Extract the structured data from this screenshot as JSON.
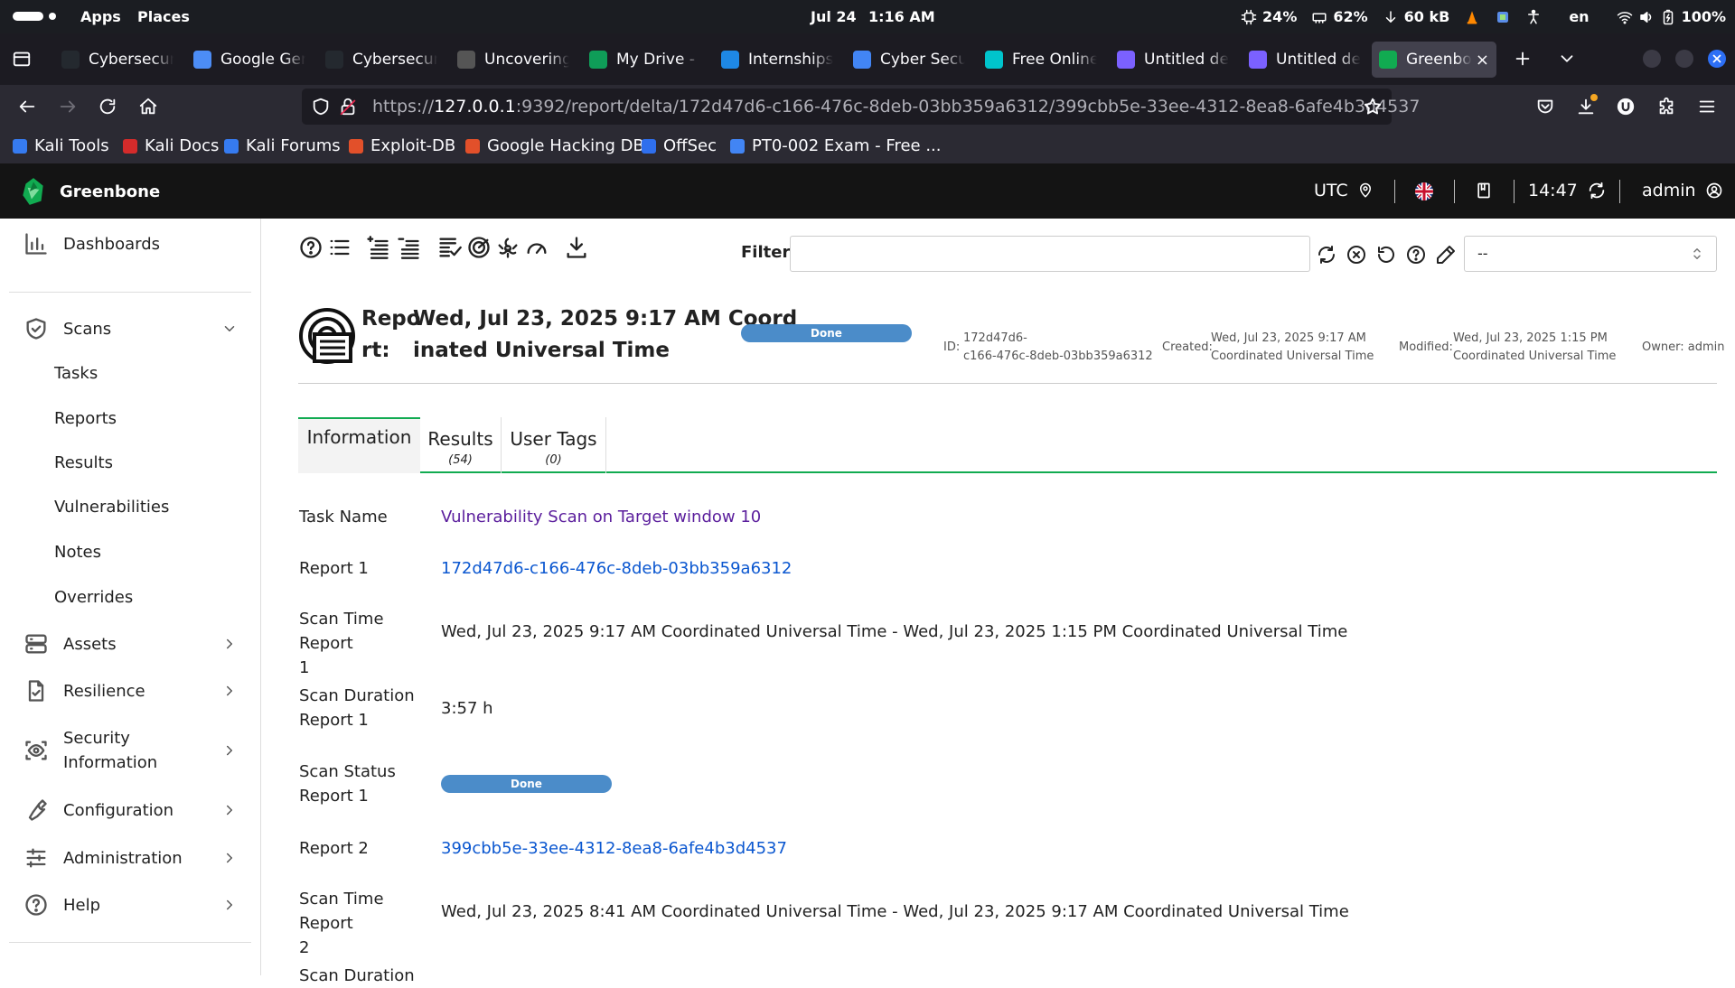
{
  "topbar": {
    "apps": "Apps",
    "places": "Places",
    "date": "Jul 24",
    "time": "1:16 AM",
    "cpu": "24%",
    "mem": "62%",
    "net": "60 kB",
    "lang": "en",
    "battery": "100%"
  },
  "tabs": [
    {
      "label": "Cybersecur",
      "color": "#24292f"
    },
    {
      "label": "Google Ger",
      "color": "#4c8df6"
    },
    {
      "label": "Cybersecur",
      "color": "#24292f"
    },
    {
      "label": "Uncovering",
      "color": "#555555"
    },
    {
      "label": "My Drive - (",
      "color": "#0f9d58"
    },
    {
      "label": "Internships",
      "color": "#1e88e5"
    },
    {
      "label": "Cyber Secu",
      "color": "#4285f4"
    },
    {
      "label": "Free Online",
      "color": "#00c4cc"
    },
    {
      "label": "Untitled de",
      "color": "#7b61ff"
    },
    {
      "label": "Untitled de",
      "color": "#7b61ff"
    },
    {
      "label": "Greenbo",
      "color": "#11ab51",
      "active": true,
      "close": "×"
    }
  ],
  "url": {
    "proto": "https://",
    "host": "127.0.0.1",
    "path": ":9392/report/delta/172d47d6-c166-476c-8deb-03bb359a6312/399cbb5e-33ee-4312-8ea8-6afe4b3d4537"
  },
  "bookmarks": [
    {
      "label": "Kali Tools",
      "color": "#367bf0"
    },
    {
      "label": "Kali Docs",
      "color": "#d42b2b"
    },
    {
      "label": "Kali Forums",
      "color": "#367bf0"
    },
    {
      "label": "Exploit-DB",
      "color": "#e2502a"
    },
    {
      "label": "Google Hacking DB",
      "color": "#e2502a"
    },
    {
      "label": "OffSec",
      "color": "#2f6fed"
    },
    {
      "label": "PT0-002 Exam - Free ...",
      "color": "#4285f4"
    }
  ],
  "gsa_header": {
    "brand": "Greenbone",
    "timezone": "UTC",
    "clock": "14:47",
    "user": "admin"
  },
  "sidebar": {
    "dashboards": "Dashboards",
    "scans": "Scans",
    "scan_items": [
      "Tasks",
      "Reports",
      "Results",
      "Vulnerabilities",
      "Notes",
      "Overrides"
    ],
    "assets": "Assets",
    "resilience": "Resilience",
    "security_info_1": "Security",
    "security_info_2": "Information",
    "configuration": "Configuration",
    "administration": "Administration",
    "help": "Help"
  },
  "filter": {
    "label": "Filter",
    "value": "",
    "select": "--"
  },
  "report": {
    "title_a": "Repo",
    "title_b": "rt:",
    "title_c": "Wed, Jul 23, 2025 9:17 AM Coord",
    "title_d": "inated Universal Time",
    "status": "Done",
    "id_label": "ID:",
    "id_1": "172d47d6-",
    "id_2": "c166-476c-8deb-03bb359a6312",
    "created_label": "Created:",
    "created_1": "Wed, Jul 23, 2025 9:17 AM",
    "created_2": "Coordinated Universal Time",
    "modified_label": "Modified:",
    "modified_1": "Wed, Jul 23, 2025 1:15 PM",
    "modified_2": "Coordinated Universal Time",
    "owner": "Owner: admin"
  },
  "detail_tabs": [
    {
      "label": "Information",
      "count": ""
    },
    {
      "label": "Results",
      "count": "(54)"
    },
    {
      "label": "User Tags",
      "count": "(0)"
    }
  ],
  "info": {
    "task_name_label": "Task Name",
    "task_name": "Vulnerability Scan on Target window 10",
    "report1_label": "Report 1",
    "report1": "172d47d6-c166-476c-8deb-03bb359a6312",
    "scan_time1_label_a": "Scan Time Report",
    "scan_time1_label_b": "1",
    "scan_time1": "Wed, Jul 23, 2025 9:17 AM Coordinated Universal Time - Wed, Jul 23, 2025 1:15 PM Coordinated Universal Time",
    "duration1_label_a": "Scan Duration",
    "duration1_label_b": "Report 1",
    "duration1": "3:57 h",
    "status1_label_a": "Scan Status",
    "status1_label_b": "Report 1",
    "status1": "Done",
    "report2_label": "Report 2",
    "report2": "399cbb5e-33ee-4312-8ea8-6afe4b3d4537",
    "scan_time2_label_a": "Scan Time Report",
    "scan_time2_label_b": "2",
    "scan_time2": "Wed, Jul 23, 2025 8:41 AM Coordinated Universal Time - Wed, Jul 23, 2025 9:17 AM Coordinated Universal Time",
    "duration2_label_a": "Scan Duration"
  }
}
